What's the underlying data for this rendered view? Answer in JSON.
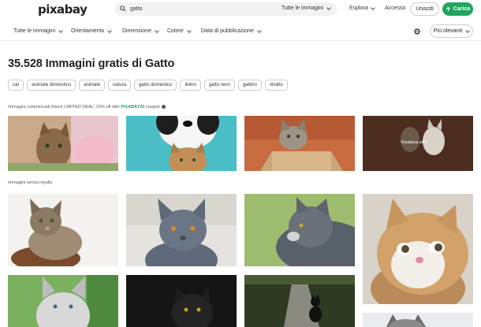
{
  "header": {
    "logo": "pixabay",
    "search_value": "gatto",
    "search_filter": "Tutte le immagini",
    "explore": "Esplora",
    "login": "Accesso",
    "signup": "Unisciti",
    "upload": "Carica"
  },
  "filters": {
    "items": [
      "Tutte le immagini",
      "Orientamento",
      "Dimensione",
      "Colore",
      "Data di pubblicazione"
    ],
    "sort": "Più rilevanti"
  },
  "main": {
    "title": "35.528 Immagini gratis di Gatto",
    "tags": [
      "cat",
      "animale domestico",
      "animale",
      "natura",
      "gatto domestico",
      "felino",
      "gatto nero",
      "gattino",
      "ritratto"
    ],
    "promo_text": "Immagini commerciali iStock LIMITED DEAL: 20% off with ",
    "promo_code": "PIXABAY20",
    "promo_suffix": " coupon",
    "overlay_text": "Visualizza altro",
    "section_label": "Immagini senza royalty"
  },
  "colors": {
    "accent": "#1fa55d"
  }
}
